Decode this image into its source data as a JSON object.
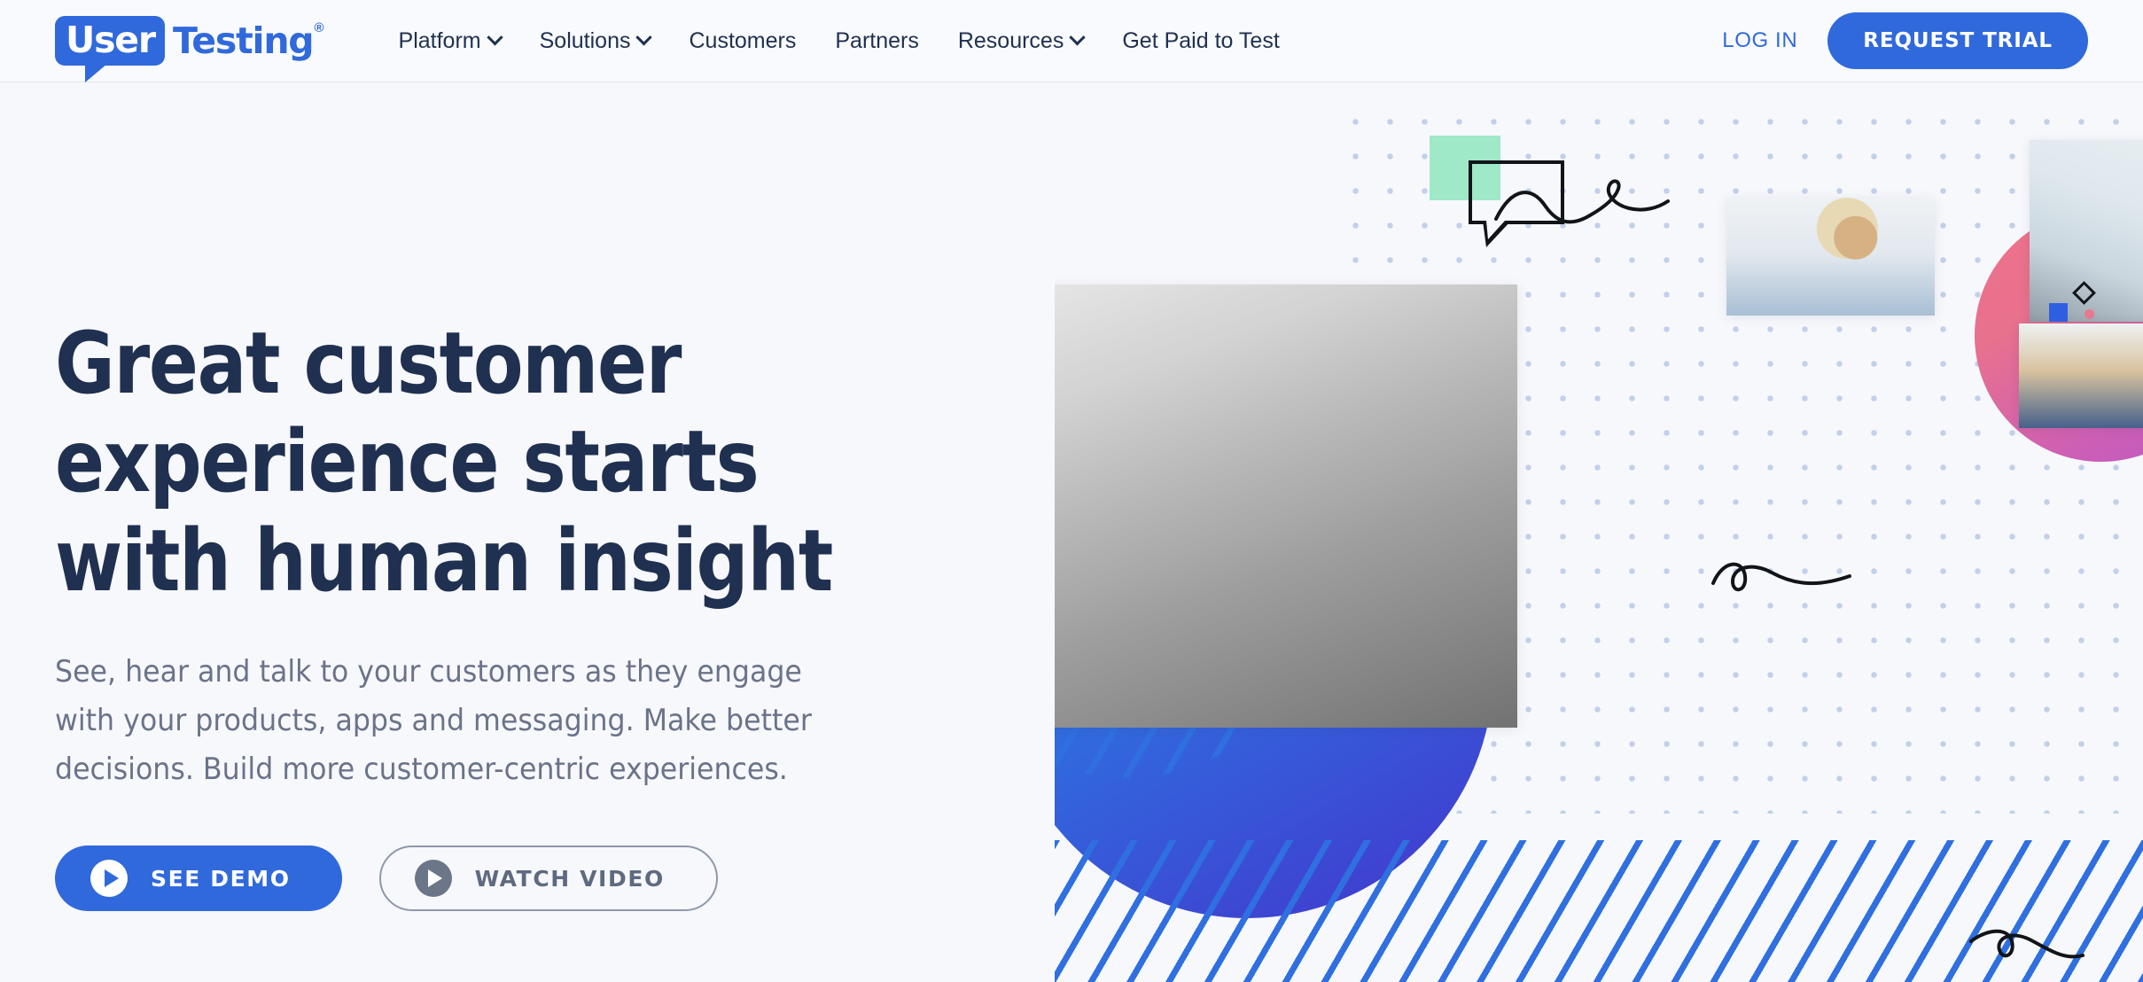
{
  "brand": {
    "logo_primary": "User",
    "logo_secondary": "Testing",
    "logo_trademark": "®",
    "accent_blue": "#3069db",
    "dark_navy": "#1f3050",
    "body_gray": "#6a7389",
    "mint": "#9fe8c8",
    "pink": "#e8788f",
    "page_background": "#f7f8fc"
  },
  "nav": {
    "items": [
      {
        "label": "Platform",
        "has_dropdown": true,
        "icon": "chevron-down-icon"
      },
      {
        "label": "Solutions",
        "has_dropdown": true,
        "icon": "chevron-down-icon"
      },
      {
        "label": "Customers",
        "has_dropdown": false,
        "icon": ""
      },
      {
        "label": "Partners",
        "has_dropdown": false,
        "icon": ""
      },
      {
        "label": "Resources",
        "has_dropdown": true,
        "icon": "chevron-down-icon"
      },
      {
        "label": "Get Paid to Test",
        "has_dropdown": false,
        "icon": ""
      }
    ],
    "login_label": "LOG IN",
    "trial_label": "REQUEST TRIAL"
  },
  "hero": {
    "headline_line1": "Great customer",
    "headline_line2": "experience starts",
    "headline_line3": "with human insight",
    "subhead_line1": "See, hear and talk to your customers as they engage",
    "subhead_line2": "with your products, apps and messaging. Make better",
    "subhead_line3": "decisions. Build more customer-centric experiences.",
    "cta_primary": "SEE DEMO",
    "cta_secondary": "WATCH VIDEO",
    "cta_primary_icon": "play-icon",
    "cta_secondary_icon": "play-icon"
  },
  "collage": {
    "photos": [
      {
        "name": "woman-with-phone-photo"
      },
      {
        "name": "man-with-laptop-photo"
      },
      {
        "name": "team-collaboration-photo"
      },
      {
        "name": "man-with-headphones-photo"
      }
    ],
    "decorations": [
      "speech-bubble-outline",
      "mint-square",
      "squiggle-line",
      "dot-grid",
      "pink-gradient-circle",
      "blue-gradient-circle",
      "diagonal-stripes",
      "diamond-outline",
      "blue-square",
      "pink-dot"
    ]
  }
}
